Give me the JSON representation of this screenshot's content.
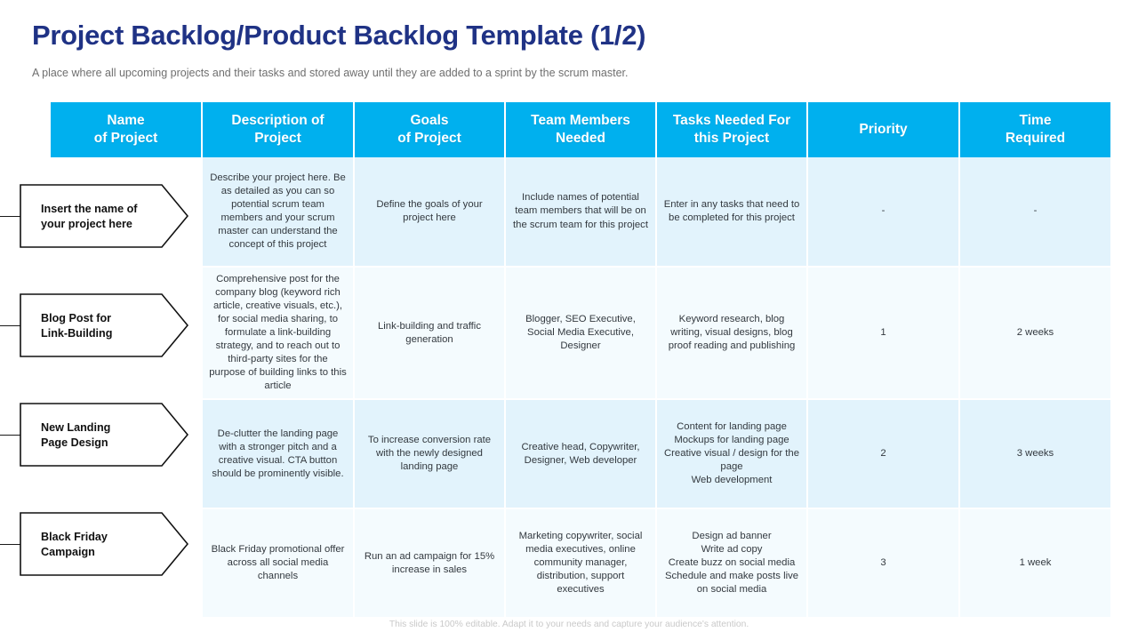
{
  "slide": {
    "title": "Project Backlog/Product Backlog Template (1/2)",
    "subtitle": "A place where all upcoming projects and their tasks and stored away until they are added to a sprint by the scrum master.",
    "footer_note": "This slide is 100% editable. Adapt it to your needs and capture your audience's attention.",
    "title_color": "#1F3285",
    "header_color": "#00B0EE",
    "band_a_color": "#E2F3FC",
    "band_b_color": "#F4FBFE"
  },
  "table": {
    "headers": [
      {
        "line1": "Name",
        "line2": "of Project"
      },
      {
        "line1": "Description of",
        "line2": "Project"
      },
      {
        "line1": "Goals",
        "line2": "of Project"
      },
      {
        "line1": "Team Members",
        "line2": "Needed"
      },
      {
        "line1": "Tasks Needed For",
        "line2": "this Project"
      },
      {
        "line1": "Priority",
        "line2": ""
      },
      {
        "line1": "Time",
        "line2": "Required"
      }
    ],
    "rows": [
      {
        "name": {
          "line1": "Insert the name of",
          "line2": "your project here"
        },
        "description": "Describe your project here. Be as detailed as you can so potential scrum team members and your scrum master can understand the concept of this project",
        "goals": "Define the goals of your project here",
        "team": "Include names of potential team members that will be on the scrum team for this project",
        "tasks": "Enter in any tasks that need to be completed for this project",
        "priority": "-",
        "time": "-"
      },
      {
        "name": {
          "line1": "Blog Post for",
          "line2": "Link-Building"
        },
        "description": "Comprehensive post for the company blog (keyword rich article, creative visuals, etc.), for social media sharing, to formulate a link-building strategy, and to reach out to third-party sites for the purpose of building links to this article",
        "goals": "Link-building and traffic generation",
        "team": "Blogger, SEO Executive, Social Media Executive, Designer",
        "tasks": "Keyword research, blog writing, visual designs, blog proof reading and publishing",
        "priority": "1",
        "time": "2 weeks"
      },
      {
        "name": {
          "line1": "New Landing",
          "line2": "Page Design"
        },
        "description": "De-clutter the landing page with a stronger pitch and a creative visual. CTA  button should be prominently visible.",
        "goals": "To increase conversion rate with the newly designed landing page",
        "team": "Creative head, Copywriter, Designer, Web developer",
        "tasks_lines": [
          "Content for landing page",
          "Mockups for landing page",
          "Creative visual / design for the page",
          "Web development"
        ],
        "priority": "2",
        "time": "3 weeks"
      },
      {
        "name": {
          "line1": "Black Friday",
          "line2": "Campaign"
        },
        "description": "Black Friday promotional offer across all social media channels",
        "goals": "Run an ad campaign for 15% increase in sales",
        "team": "Marketing copywriter, social media executives, online community manager, distribution, support executives",
        "tasks_lines": [
          "Design ad banner",
          "Write ad copy",
          "Create buzz  on social media",
          "Schedule and make posts live on social media"
        ],
        "priority": "3",
        "time": "1 week"
      }
    ]
  }
}
